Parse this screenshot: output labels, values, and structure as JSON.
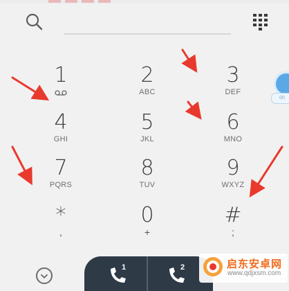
{
  "dialer": {
    "number_value": "",
    "keys": [
      {
        "digit": "1",
        "letters": "",
        "icon": "voicemail-icon"
      },
      {
        "digit": "2",
        "letters": "ABC"
      },
      {
        "digit": "3",
        "letters": "DEF"
      },
      {
        "digit": "4",
        "letters": "GHI"
      },
      {
        "digit": "5",
        "letters": "JKL"
      },
      {
        "digit": "6",
        "letters": "MNO"
      },
      {
        "digit": "7",
        "letters": "PQRS"
      },
      {
        "digit": "8",
        "letters": "TUV"
      },
      {
        "digit": "9",
        "letters": "WXYZ"
      },
      {
        "digit": "*",
        "letters": ","
      },
      {
        "digit": "0",
        "letters": "+"
      },
      {
        "digit": "#",
        "letters": ";"
      }
    ]
  },
  "call_bar": {
    "sim1_label": "1",
    "sim2_label": "2"
  },
  "side": {
    "chip_label": "00"
  },
  "watermark": {
    "title": "启东安卓网",
    "url": "www.qdjxsm.com"
  },
  "icons": {
    "search": "search-icon",
    "dialpad": "dialpad-grid-icon",
    "history": "chevron-down-icon",
    "call": "phone-icon"
  },
  "colors": {
    "background": "#f1f1f1",
    "arrow": "#e8392d",
    "call_bar": "#2f3a47",
    "accent": "#5aa9e6"
  }
}
